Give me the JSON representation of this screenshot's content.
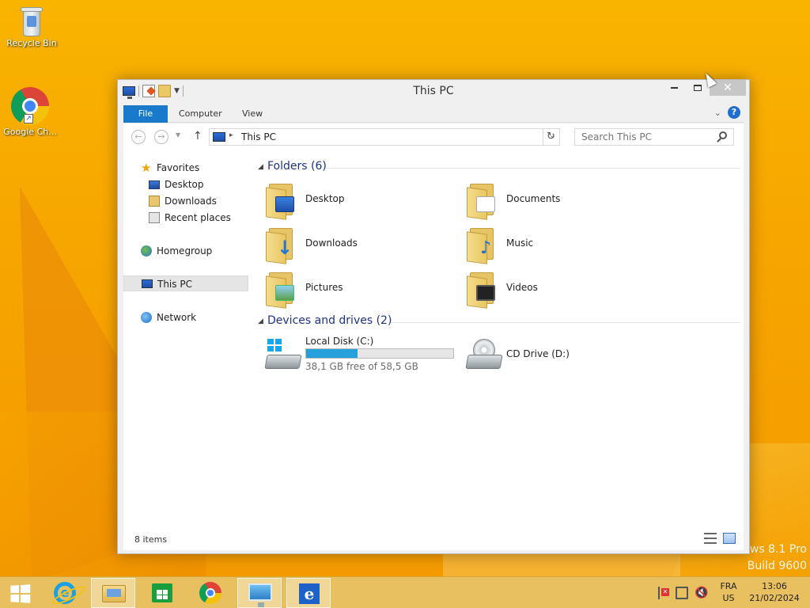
{
  "desktop": {
    "icons": [
      {
        "label": "Recycle Bin",
        "icon": "recycle-bin-icon"
      },
      {
        "label": "Google Ch...",
        "icon": "chrome-icon"
      }
    ],
    "watermark": {
      "line1": "ows 8.1 Pro",
      "line2": "Build 9600"
    }
  },
  "window": {
    "title": "This PC",
    "controls": {
      "close": "✕"
    },
    "ribbon": {
      "tabs": [
        {
          "label": "File",
          "active": true
        },
        {
          "label": "Computer"
        },
        {
          "label": "View"
        }
      ],
      "help": "?"
    },
    "nav": {
      "back": "←",
      "forward": "→",
      "up": "↑",
      "address_arrow": "▸",
      "address": "This PC",
      "refresh": "↻",
      "search_placeholder": "Search This PC"
    },
    "sidebar": {
      "items": [
        {
          "label": "Favorites",
          "icon": "star-icon",
          "level": 0
        },
        {
          "label": "Desktop",
          "icon": "desktop-icon",
          "level": 1
        },
        {
          "label": "Downloads",
          "icon": "downloads-icon",
          "level": 1
        },
        {
          "label": "Recent places",
          "icon": "recent-places-icon",
          "level": 1
        },
        {
          "label": "Homegroup",
          "icon": "homegroup-icon",
          "level": 0
        },
        {
          "label": "This PC",
          "icon": "this-pc-icon",
          "level": 0,
          "selected": true
        },
        {
          "label": "Network",
          "icon": "network-icon",
          "level": 0
        }
      ]
    },
    "folders_group": {
      "title": "Folders (6)",
      "items": [
        {
          "label": "Desktop",
          "icon": "desktop-folder-icon"
        },
        {
          "label": "Documents",
          "icon": "documents-folder-icon"
        },
        {
          "label": "Downloads",
          "icon": "downloads-folder-icon"
        },
        {
          "label": "Music",
          "icon": "music-folder-icon"
        },
        {
          "label": "Pictures",
          "icon": "pictures-folder-icon"
        },
        {
          "label": "Videos",
          "icon": "videos-folder-icon"
        }
      ]
    },
    "drives_group": {
      "title": "Devices and drives (2)",
      "items": [
        {
          "label": "Local Disk (C:)",
          "icon": "hard-disk-icon",
          "free_text": "38,1 GB free of 58,5 GB",
          "used_fraction": 0.349
        },
        {
          "label": "CD Drive (D:)",
          "icon": "cd-drive-icon"
        }
      ]
    },
    "status": {
      "items": "8 items"
    }
  },
  "taskbar": {
    "apps": [
      {
        "name": "internet-explorer",
        "active": false
      },
      {
        "name": "file-explorer",
        "active": true
      },
      {
        "name": "store",
        "active": false
      },
      {
        "name": "chrome",
        "active": false
      },
      {
        "name": "remote-desktop",
        "active": true
      },
      {
        "name": "internet-explorer-2",
        "active": true
      }
    ],
    "tray": {
      "lang_line1": "FRA",
      "lang_line2": "US",
      "time": "13:06",
      "date": "21/02/2024",
      "volume": "🔇"
    }
  },
  "colors": {
    "accent": "#1979ca",
    "progress": "#26a0da",
    "group_title": "#1e3287"
  }
}
